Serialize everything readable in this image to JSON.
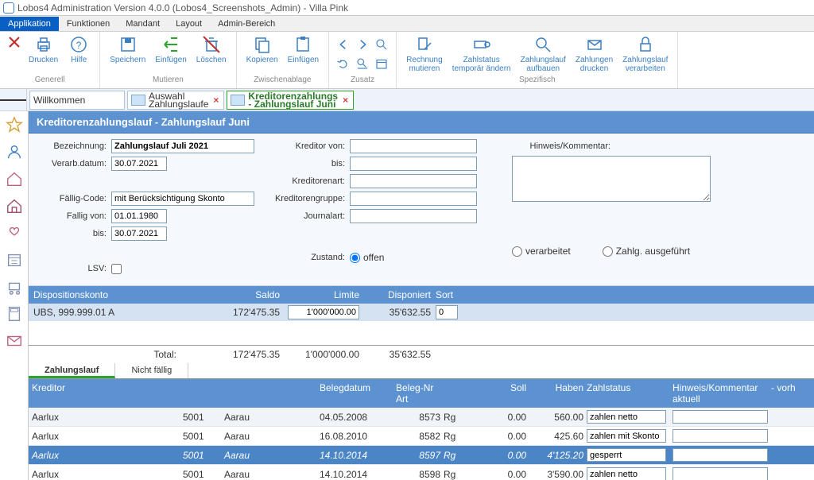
{
  "window": {
    "title": "Lobos4 Administration Version 4.0.0 (Lobos4_Screenshots_Admin) - Villa Pink"
  },
  "menu": {
    "tabs": [
      "Applikation",
      "Funktionen",
      "Mandant",
      "Layout",
      "Admin-Bereich"
    ],
    "active": 0
  },
  "ribbon": {
    "groups": {
      "generell": {
        "label": "Generell",
        "close": "×",
        "drucken": "Drucken",
        "hilfe": "Hilfe"
      },
      "mutieren": {
        "label": "Mutieren",
        "speichern": "Speichern",
        "einfuegen": "Einfügen",
        "loeschen": "Löschen"
      },
      "zwischenablage": {
        "label": "Zwischenablage",
        "kopieren": "Kopieren",
        "einfuegen": "Einfügen"
      },
      "zusatz": {
        "label": "Zusatz"
      },
      "spezifisch": {
        "label": "Spezifisch",
        "rechnung_mutieren": "Rechnung\nmutieren",
        "zahlstatus_temp": "Zahlstatus\ntemporär ändern",
        "zahlungslauf_aufbauen": "Zahlungslauf\naufbauen",
        "zahlungen_drucken": "Zahlungen\ndrucken",
        "zahlungslauf_verarbeiten": "Zahlungslauf\nverarbeiten"
      }
    }
  },
  "tabs": {
    "welcome": "Willkommen",
    "auswahl": {
      "line1": "Auswahl",
      "line2": "Zahlungslaufe"
    },
    "kreditoren": {
      "line1": "Kreditorenzahlungs",
      "line2": "- Zahlungslauf Juni"
    }
  },
  "page": {
    "title": "Kreditorenzahlungslauf - Zahlungslauf Juni"
  },
  "form": {
    "bezeichnung": {
      "label": "Bezeichnung:",
      "value": "Zahlungslauf Juli 2021"
    },
    "verarb_datum": {
      "label": "Verarb.datum:",
      "value": "30.07.2021"
    },
    "faellig_code": {
      "label": "Fällig-Code:",
      "value": "mit Berücksichtigung Skonto"
    },
    "faellig_von": {
      "label": "Fallig von:",
      "value": "01.01.1980"
    },
    "bis": {
      "label": "bis:",
      "value": "30.07.2021"
    },
    "lsv": {
      "label": "LSV:"
    },
    "kreditor_von": {
      "label": "Kreditor von:"
    },
    "kreditor_bis": {
      "label": "bis:"
    },
    "kreditorenart": {
      "label": "Kreditorenart:"
    },
    "kreditorengruppe": {
      "label": "Kreditorengruppe:"
    },
    "journalart": {
      "label": "Journalart:"
    },
    "zustand": {
      "label": "Zustand:",
      "offen": "offen",
      "verarbeitet": "verarbeitet",
      "ausgefuehrt": "Zahlg. ausgeführt"
    },
    "hinweis": {
      "label": "Hinweis/Kommentar:"
    }
  },
  "dispo": {
    "header": {
      "konto": "Dispositionskonto",
      "saldo": "Saldo",
      "limite": "Limite",
      "disponiert": "Disponiert",
      "sort": "Sort"
    },
    "row": {
      "konto": "UBS, 999.999.01 A",
      "saldo": "172'475.35",
      "limite": "1'000'000.00",
      "disponiert": "35'632.55",
      "sort": "0"
    },
    "total": {
      "label": "Total:",
      "saldo": "172'475.35",
      "limite": "1'000'000.00",
      "disponiert": "35'632.55"
    }
  },
  "subtabs": {
    "zahlungslauf": "Zahlungslauf",
    "nichtfaellig": "Nicht fällig"
  },
  "grid": {
    "header": {
      "kreditor": "Kreditor",
      "belegdatum": "Belegdatum",
      "belegnr_art": "Beleg-Nr Art",
      "soll": "Soll",
      "haben": "Haben",
      "zahlstatus": "Zahlstatus",
      "hinweis": "Hinweis/Kommentar aktuell",
      "vorh": "- vorh"
    },
    "rows": [
      {
        "kreditor": "Aarlux",
        "nr": "5001",
        "ort": "Aarau",
        "belegdatum": "04.05.2008",
        "belegnr": "8573",
        "art": "Rg",
        "soll": "0.00",
        "haben": "560.00",
        "status": "zahlen netto",
        "hinweis": "",
        "sel": false
      },
      {
        "kreditor": "Aarlux",
        "nr": "5001",
        "ort": "Aarau",
        "belegdatum": "16.08.2010",
        "belegnr": "8582",
        "art": "Rg",
        "soll": "0.00",
        "haben": "425.60",
        "status": "zahlen mit Skonto",
        "hinweis": "",
        "sel": false
      },
      {
        "kreditor": "Aarlux",
        "nr": "5001",
        "ort": "Aarau",
        "belegdatum": "14.10.2014",
        "belegnr": "8597",
        "art": "Rg",
        "soll": "0.00",
        "haben": "4'125.20",
        "status": "gesperrt",
        "hinweis": "",
        "sel": true
      },
      {
        "kreditor": "Aarlux",
        "nr": "5001",
        "ort": "Aarau",
        "belegdatum": "14.10.2014",
        "belegnr": "8598",
        "art": "Rg",
        "soll": "0.00",
        "haben": "3'590.00",
        "status": "zahlen netto",
        "hinweis": "",
        "sel": false
      }
    ]
  }
}
